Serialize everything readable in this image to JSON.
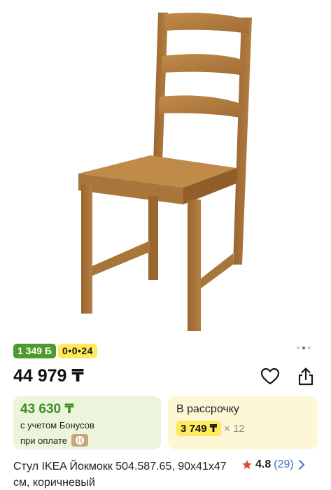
{
  "product": {
    "image_alt": "Стул IKEA Йокмокк",
    "pager": {
      "total": 3,
      "active": 1
    },
    "badges": {
      "bonus": "1 349 Б",
      "installment": "0•0•24"
    },
    "price": "44 979 ₸",
    "bonus_card": {
      "price": "43 630 ₸",
      "line1": "с учетом Бонусов",
      "line2": "при оплате"
    },
    "installment_card": {
      "title": "В рассрочку",
      "amount": "3 749 ₸",
      "multiplier": "× 12"
    },
    "title": "Стул IKEA Йокмокк 504.587.65, 90x41x47 см, коричневый",
    "rating": {
      "value": "4.8",
      "count": "(29)"
    }
  },
  "icons": {
    "favorite": "heart-outline-icon",
    "share": "share-icon",
    "star": "star-icon",
    "chevron": "chevron-right-icon",
    "kaspi": "kaspi-logo-icon"
  },
  "colors": {
    "bonus_green": "#4e9a2c",
    "installment_yellow": "#ffe95c",
    "link_blue": "#3a76c4",
    "star_red": "#e2452f",
    "wood": "#b07d3e"
  }
}
